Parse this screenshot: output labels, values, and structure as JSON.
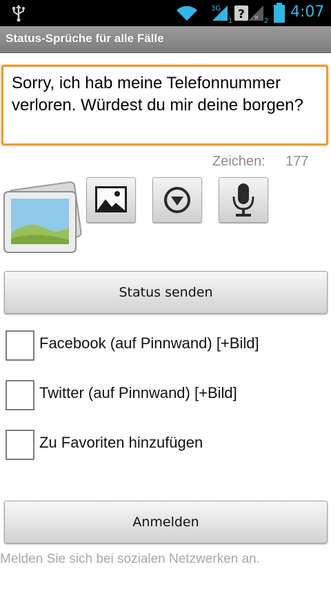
{
  "status_bar": {
    "time": "4:07",
    "icons": [
      "usb-icon",
      "wifi-icon",
      "signal-3g-icon",
      "signal-no-sim-icon",
      "battery-icon"
    ],
    "network_badge": "3G",
    "sim1": "1",
    "sim2": "2",
    "no_sim": "?",
    "time_color": "#33b5e5"
  },
  "title_bar": {
    "title": "Status-Sprüche für alle Fälle"
  },
  "message": {
    "text": "Sorry, ich hab meine Telefonnummer verloren. Würdest du mir deine borgen?",
    "border_color": "#f29a2e"
  },
  "counter": {
    "label": "Zeichen:",
    "value": "177"
  },
  "toolbar": {
    "preview_icon": "photo-gallery-icon",
    "gallery_icon": "picture-icon",
    "dropdown_icon": "dropdown-circle-icon",
    "mic_icon": "microphone-icon"
  },
  "buttons": {
    "send_status": "Status senden",
    "login": "Anmelden"
  },
  "options": [
    {
      "label": "Facebook (auf Pinnwand) [+Bild]",
      "checked": false
    },
    {
      "label": "Twitter (auf Pinnwand) [+Bild]",
      "checked": false
    },
    {
      "label": "Zu Favoriten hinzufügen",
      "checked": false
    }
  ],
  "hint": "Melden Sie sich bei sozialen Netzwerken an."
}
